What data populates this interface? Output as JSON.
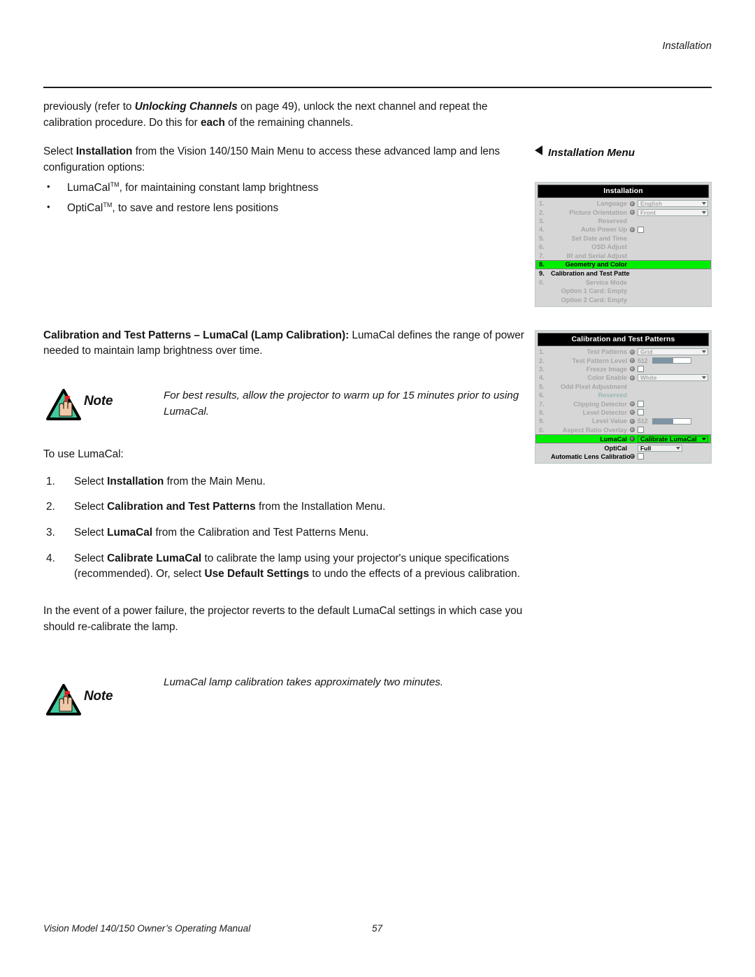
{
  "header": {
    "chapter": "Installation"
  },
  "footer": {
    "manual": "Vision Model 140/150 Owner’s Operating Manual",
    "page": "57"
  },
  "body": {
    "p1_a": "previously (refer to ",
    "p1_b": "Unlocking Channels",
    "p1_c": " on page 49), unlock the next channel and repeat the calibration procedure. Do this for ",
    "p1_d": "each",
    "p1_e": " of the remaining channels.",
    "p2_a": "Select ",
    "p2_b": "Installation",
    "p2_c": " from the Vision 140/150 Main Menu to access these advanced lamp and lens configuration options:",
    "bullet1_a": "LumaCal",
    "bullet1_tm": "TM",
    "bullet1_b": ", for maintaining constant lamp brightness",
    "bullet2_a": "OptiCal",
    "bullet2_tm": "TM",
    "bullet2_b": ", to save and restore lens positions",
    "p3_a": "Calibration and Test Patterns – LumaCal (Lamp Calibration):",
    "p3_b": " LumaCal defines the range of power needed to maintain lamp brightness over time.",
    "note1_word": "Note",
    "note1_text": "For best results, allow the projector to warm up for 15 minutes prior to using LumaCal.",
    "p4": "To use LumaCal:",
    "step1_num": "1.",
    "step1_a": "Select ",
    "step1_b": "Installation",
    "step1_c": " from the Main Menu.",
    "step2_num": "2.",
    "step2_a": "Select ",
    "step2_b": "Calibration and Test Patterns",
    "step2_c": " from the Installation Menu.",
    "step3_num": "3.",
    "step3_a": "Select ",
    "step3_b": "LumaCal",
    "step3_c": " from the Calibration and Test Patterns Menu.",
    "step4_num": "4.",
    "step4_a": "Select ",
    "step4_b": "Calibrate LumaCal",
    "step4_c": " to calibrate the lamp using your projector's unique specifications (recommended). Or, select ",
    "step4_d": "Use Default Settings",
    "step4_e": " to undo the effects of a previous calibration.",
    "p5": "In the event of a power failure, the projector reverts to the default LumaCal settings in which case you should re-calibrate the lamp.",
    "note2_word": "Note",
    "note2_text": "LumaCal lamp calibration takes approximately two minutes."
  },
  "side": {
    "caption1": "Installation Menu"
  },
  "menu_installation": {
    "title": "Installation",
    "rows": [
      {
        "idx": "1.",
        "label": "Language",
        "globe": true,
        "control": "dropdown",
        "value": "English"
      },
      {
        "idx": "2.",
        "label": "Picture Orientation",
        "globe": true,
        "control": "dropdown",
        "value": "Front"
      },
      {
        "idx": "3.",
        "label": "Reserved",
        "globe": false,
        "control": "none",
        "value": ""
      },
      {
        "idx": "4.",
        "label": "Auto Power Up",
        "globe": true,
        "control": "checkbox",
        "value": ""
      },
      {
        "idx": "5.",
        "label": "Set Date and Time",
        "globe": false,
        "control": "none",
        "value": ""
      },
      {
        "idx": "6.",
        "label": "OSD Adjust",
        "globe": false,
        "control": "none",
        "value": ""
      },
      {
        "idx": "7.",
        "label": "IR and Serial Adjust",
        "globe": false,
        "control": "none",
        "value": ""
      },
      {
        "idx": "8.",
        "label": "Geometry and Color",
        "globe": false,
        "control": "none",
        "value": "",
        "highlight": true
      },
      {
        "idx": "9.",
        "label": "Calibration and Test Patterns",
        "globe": false,
        "control": "none",
        "value": "",
        "dark": true
      },
      {
        "idx": "0.",
        "label": "Service Mode",
        "globe": false,
        "control": "none",
        "value": ""
      },
      {
        "idx": "",
        "label": "Option 1 Card: Empty",
        "globe": false,
        "control": "none",
        "value": ""
      },
      {
        "idx": "",
        "label": "Option 2 Card: Empty",
        "globe": false,
        "control": "none",
        "value": ""
      }
    ]
  },
  "menu_calibration": {
    "title": "Calibration and Test Patterns",
    "rows": [
      {
        "idx": "1.",
        "label": "Test Patterns",
        "globe": true,
        "control": "dropdown",
        "value": "Grid"
      },
      {
        "idx": "2.",
        "label": "Test Pattern Level",
        "globe": true,
        "control": "slider",
        "value": "512"
      },
      {
        "idx": "3.",
        "label": "Freeze Image",
        "globe": true,
        "control": "checkbox",
        "value": ""
      },
      {
        "idx": "4.",
        "label": "Color Enable",
        "globe": true,
        "control": "dropdown",
        "value": "White"
      },
      {
        "idx": "5.",
        "label": "Odd Pixel Adjustment",
        "globe": false,
        "control": "none",
        "value": ""
      },
      {
        "idx": "6.",
        "label": "Reserved",
        "globe": false,
        "control": "none",
        "value": "",
        "teal": true
      },
      {
        "idx": "7.",
        "label": "Clipping Detector",
        "globe": true,
        "control": "checkbox",
        "value": ""
      },
      {
        "idx": "8.",
        "label": "Level Detector",
        "globe": true,
        "control": "checkbox",
        "value": ""
      },
      {
        "idx": "9.",
        "label": "Level Value",
        "globe": true,
        "control": "slider",
        "value": "512"
      },
      {
        "idx": "0.",
        "label": "Aspect Ratio Overlay",
        "globe": true,
        "control": "checkbox",
        "value": ""
      },
      {
        "idx": "",
        "label": "LumaCal",
        "globe": true,
        "control": "dropdown-green",
        "value": "Calibrate LumaCal",
        "highlight": true
      },
      {
        "idx": "",
        "label": "OptiCal",
        "globe": false,
        "control": "dropdown-dark",
        "value": "Full",
        "dark": true
      },
      {
        "idx": "",
        "label": "Automatic Lens Calibration",
        "globe": true,
        "control": "checkbox",
        "value": "",
        "dark": true
      }
    ]
  }
}
